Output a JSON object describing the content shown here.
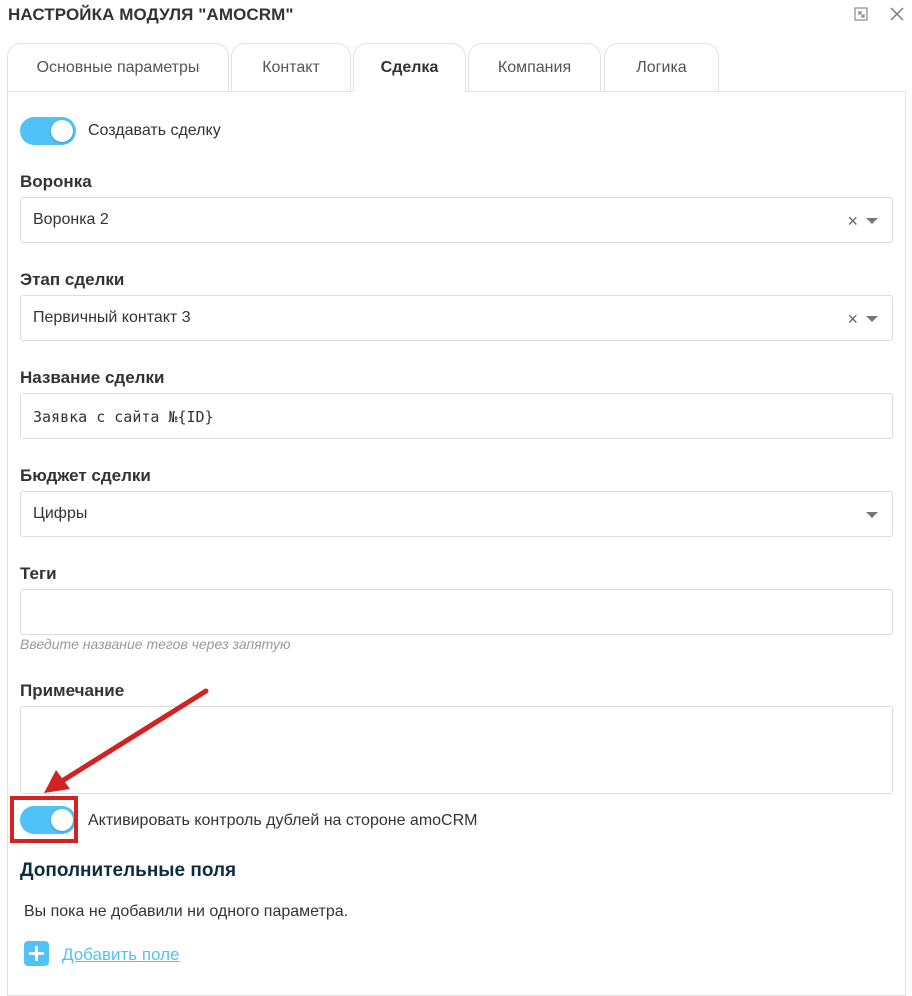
{
  "window": {
    "title": "НАСТРОЙКА МОДУЛЯ \"AMOCRM\"",
    "icons": [
      "expand-icon",
      "close-icon"
    ]
  },
  "tabs": [
    {
      "label": "Основные параметры",
      "active": false
    },
    {
      "label": "Контакт",
      "active": false
    },
    {
      "label": "Сделка",
      "active": true
    },
    {
      "label": "Компания",
      "active": false
    },
    {
      "label": "Логика",
      "active": false
    }
  ],
  "deal": {
    "create_toggle": {
      "label": "Создавать сделку",
      "on": true
    },
    "pipeline": {
      "label": "Воронка",
      "value": "Воронка 2"
    },
    "stage": {
      "label": "Этап сделки",
      "value": "Первичный контакт 3"
    },
    "name": {
      "label": "Название сделки",
      "value": "Заявка с сайта №{ID}"
    },
    "budget": {
      "label": "Бюджет сделки",
      "value": "Цифры"
    },
    "tags": {
      "label": "Теги",
      "value": "",
      "hint": "Введите название тегов через запятую"
    },
    "note": {
      "label": "Примечание",
      "value": ""
    },
    "duplicates_toggle": {
      "label": "Активировать контроль дублей на стороне amoCRM",
      "on": true
    }
  },
  "extra_fields": {
    "title": "Дополнительные поля",
    "empty_text": "Вы пока не добавили ни одного параметра.",
    "add_label": "Добавить поле"
  },
  "colors": {
    "accent": "#4fc3f7",
    "annotation": "#d32222",
    "section_title": "#0b2e3d"
  }
}
